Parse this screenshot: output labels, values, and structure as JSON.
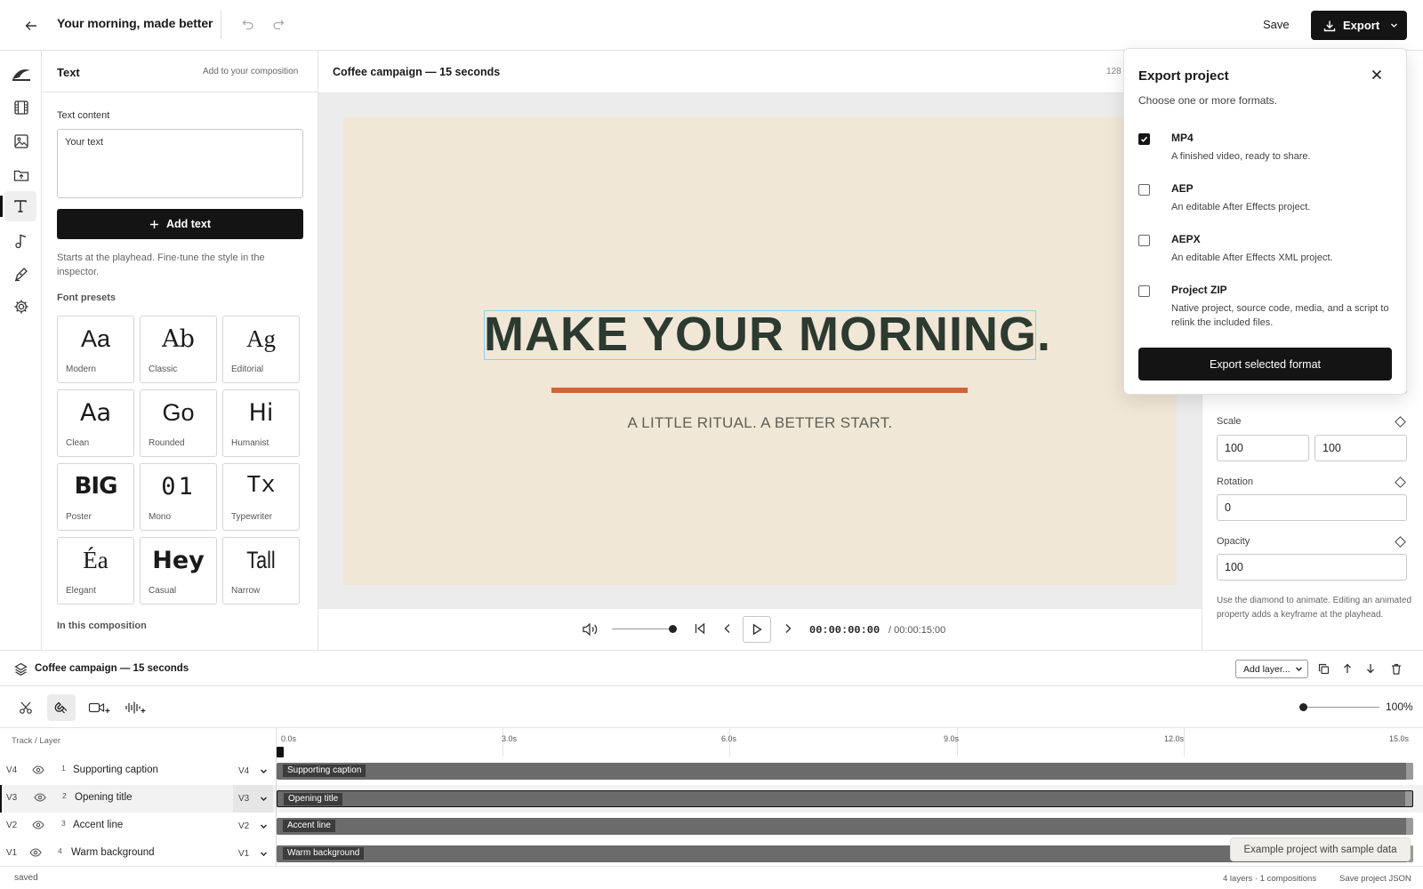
{
  "header": {
    "project_title": "Your morning, made better",
    "save_label": "Save",
    "export_label": "Export"
  },
  "rail": {
    "items": [
      "logo-icon",
      "film-icon",
      "image-icon",
      "folder-upload-icon",
      "text-icon",
      "music-note-icon",
      "pen-tool-icon",
      "gear-icon"
    ],
    "active": "text-icon"
  },
  "text_panel": {
    "title": "Text",
    "subtitle": "Add to your composition",
    "content_label": "Text content",
    "content_value": "Your text",
    "add_button": "Add text",
    "hint": "Starts at the playhead. Fine-tune the style in the inspector.",
    "presets_label": "Font presets",
    "presets": [
      {
        "sample": "Aa",
        "name": "Modern"
      },
      {
        "sample": "Ab",
        "name": "Classic"
      },
      {
        "sample": "Ag",
        "name": "Editorial"
      },
      {
        "sample": "Aa",
        "name": "Clean"
      },
      {
        "sample": "Go",
        "name": "Rounded"
      },
      {
        "sample": "Hi",
        "name": "Humanist"
      },
      {
        "sample": "BIG",
        "name": "Poster"
      },
      {
        "sample": "01",
        "name": "Mono"
      },
      {
        "sample": "Tx",
        "name": "Typewriter"
      },
      {
        "sample": "Éa",
        "name": "Elegant"
      },
      {
        "sample": "Hey",
        "name": "Casual"
      },
      {
        "sample": "Tall",
        "name": "Narrow"
      }
    ],
    "in_composition_label": "In this composition"
  },
  "preview": {
    "composition_title": "Coffee campaign — 15 seconds",
    "resolution_fragment": "128",
    "headline": "MAKE YOUR MORNING.",
    "subhead": "A LITTLE RITUAL. A BETTER START.",
    "colors": {
      "canvas": "#f1e7d7",
      "headline": "#2c3a30",
      "accent": "#d2643a",
      "selection": "#8fd0ea"
    }
  },
  "transport": {
    "timecode": "00:00:00:00",
    "total": "/ 00:00:15:00",
    "volume": 1.0
  },
  "inspector": {
    "scale_label": "Scale",
    "scale_x": "100",
    "scale_y": "100",
    "rotation_label": "Rotation",
    "rotation": "0",
    "opacity_label": "Opacity",
    "opacity": "100",
    "note": "Use the diamond to animate. Editing an animated property adds a keyframe at the playhead."
  },
  "export_popover": {
    "title": "Export project",
    "subtitle": "Choose one or more formats.",
    "options": [
      {
        "name": "MP4",
        "desc": "A finished video, ready to share.",
        "checked": true
      },
      {
        "name": "AEP",
        "desc": "An editable After Effects project.",
        "checked": false
      },
      {
        "name": "AEPX",
        "desc": "An editable After Effects XML project.",
        "checked": false
      },
      {
        "name": "Project ZIP",
        "desc": "Native project, source code, media, and a script to relink the included files.",
        "checked": false
      }
    ],
    "button": "Export selected format"
  },
  "timeline": {
    "title": "Coffee campaign — 15 seconds",
    "add_layer": "Add layer...",
    "zoom": "100%",
    "track_header": "Track / Layer",
    "ticks": [
      "0.0s",
      "3.0s",
      "6.0s",
      "9.0s",
      "12.0s",
      "15.0s"
    ],
    "tracks": [
      {
        "id": "V4",
        "index": "1",
        "name": "Supporting caption",
        "target": "V4",
        "selected": false
      },
      {
        "id": "V3",
        "index": "2",
        "name": "Opening title",
        "target": "V3",
        "selected": true
      },
      {
        "id": "V2",
        "index": "3",
        "name": "Accent line",
        "target": "V2",
        "selected": false
      },
      {
        "id": "V1",
        "index": "4",
        "name": "Warm background",
        "target": "V1",
        "selected": false
      }
    ],
    "toast": "Example project with sample data"
  },
  "status": {
    "left": "saved",
    "counts": "4 layers · 1 compositions",
    "save_json": "Save project JSON"
  }
}
